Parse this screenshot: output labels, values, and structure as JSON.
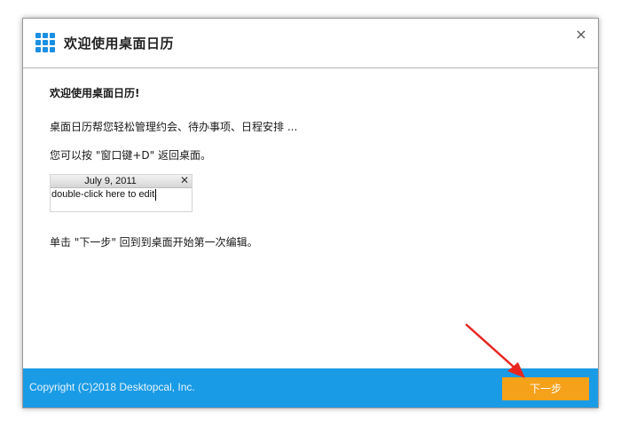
{
  "window": {
    "title": "欢迎使用桌面日历",
    "close_label": "×"
  },
  "content": {
    "heading": "欢迎使用桌面日历!",
    "line1": "桌面日历帮您轻松管理约会、待办事项、日程安排 ...",
    "line2": "您可以按 \"窗口键+D\" 返回桌面。",
    "widget": {
      "date": "July 9, 2011",
      "close_label": "✕",
      "input_value": "double-click here to edit"
    },
    "line3": "单击 \"下一步\" 回到到桌面开始第一次编辑。"
  },
  "footer": {
    "copyright": "Copyright (C)2018 Desktopcal, Inc.",
    "next_label": "下一步"
  },
  "icons": {
    "app": "grid-calendar-icon",
    "close": "close-icon",
    "arrow": "red-arrow-annotation"
  },
  "colors": {
    "footer_bg": "#1a9be6",
    "next_button_bg": "#f5a11a",
    "app_icon": "#1a8fe3",
    "arrow": "#e8261f"
  }
}
